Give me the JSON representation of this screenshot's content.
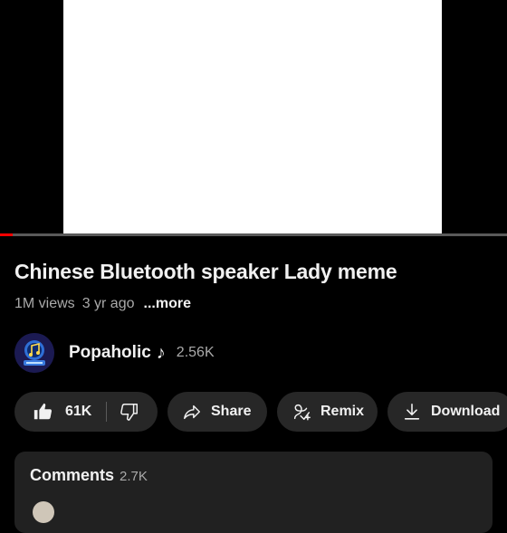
{
  "video": {
    "title": "Chinese Bluetooth speaker Lady meme",
    "views": "1M views",
    "age": "3 yr ago",
    "more_label": "...more",
    "progress_fraction": 0.025
  },
  "channel": {
    "name": "Popaholic",
    "note_glyph": "♪",
    "subscribers": "2.56K"
  },
  "actions": {
    "like_count": "61K",
    "share_label": "Share",
    "remix_label": "Remix",
    "download_label": "Download"
  },
  "comments": {
    "title": "Comments",
    "count": "2.7K"
  },
  "colors": {
    "background": "#000000",
    "pill": "#272727",
    "progress": "#ff0000",
    "comments_bg": "#212121"
  }
}
